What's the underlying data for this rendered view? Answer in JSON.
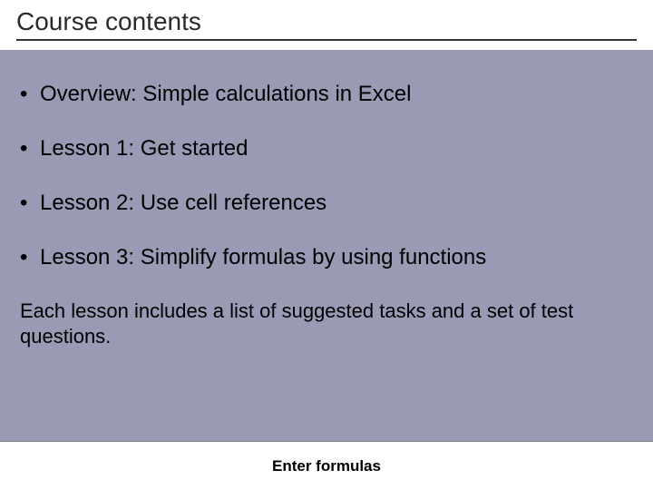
{
  "slide": {
    "title": "Course contents",
    "bullets": [
      "Overview: Simple calculations in Excel",
      "Lesson 1: Get started",
      "Lesson 2: Use cell references",
      "Lesson 3: Simplify formulas by using functions"
    ],
    "note": "Each lesson includes a list of suggested tasks and a set of test questions.",
    "footer": "Enter formulas"
  }
}
